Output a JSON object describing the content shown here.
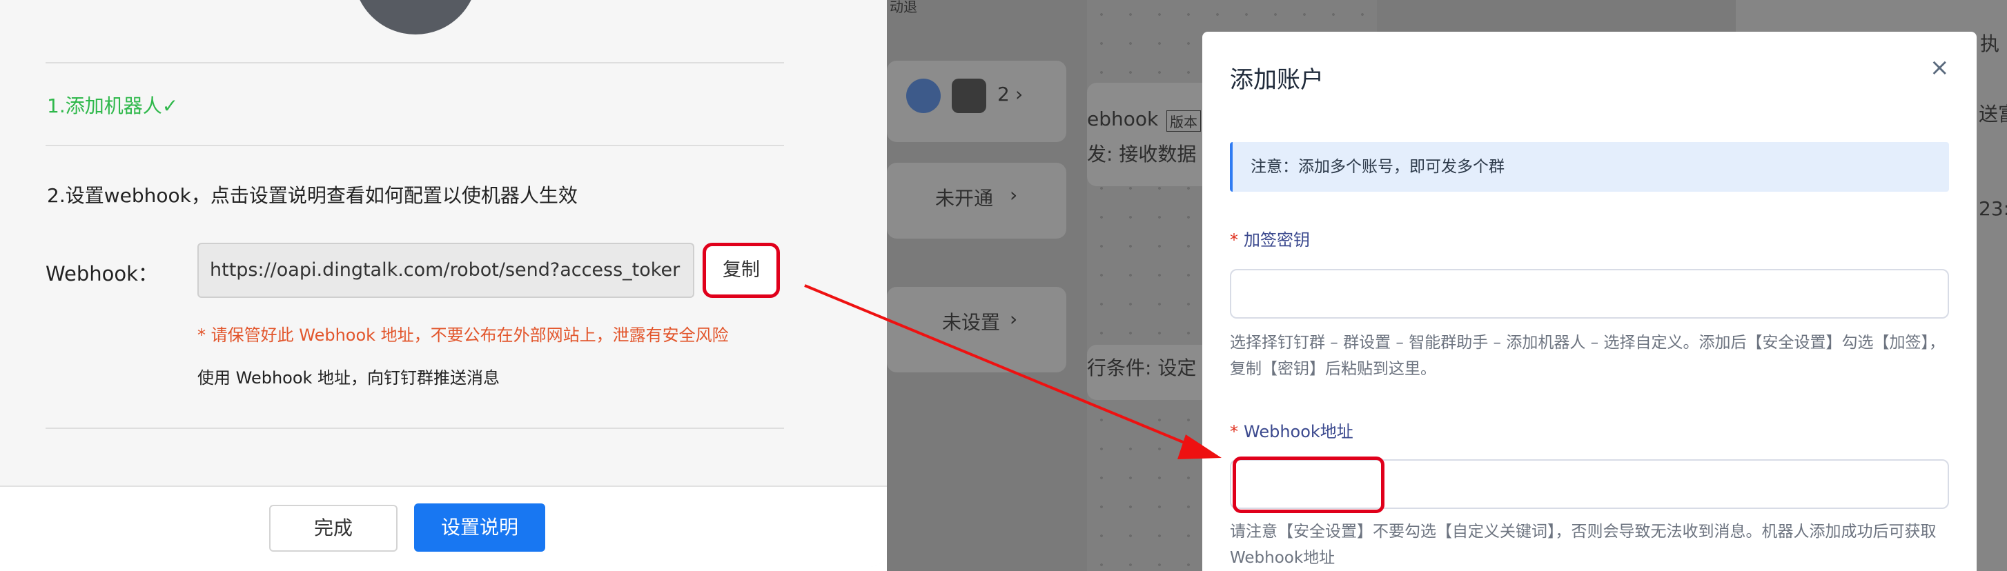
{
  "left_dialog": {
    "step1": "1.添加机器人✓",
    "step2": "2.设置webhook，点击设置说明查看如何配置以使机器人生效",
    "webhook_label": "Webhook：",
    "webhook_value": "https://oapi.dingtalk.com/robot/send?access_toker",
    "copy_button": "复制",
    "warning": "* 请保管好此 Webhook 地址，不要公布在外部网站上，泄露有安全风险",
    "info": "使用 Webhook 地址，向钉钉群推送消息",
    "done_button": "完成",
    "setup_button": "设置说明"
  },
  "background": {
    "top_text": "动退",
    "count": "2",
    "webhook_text": "ebhook",
    "version_badge": "版本",
    "receive_text": "发: 接收数据",
    "not_enabled": "未开通",
    "not_set": "未设置",
    "condition_text": "行条件: 设定",
    "right_top": "执",
    "right_send": "送富",
    "right_time": "23:"
  },
  "modal": {
    "title": "添加账户",
    "close_icon": "×",
    "notice": "注意：添加多个账号，即可发多个群",
    "sign_label": "加签密钥",
    "sign_help": "选择择钉钉群 – 群设置  – 智能群助手 – 添加机器人 – 选择自定义。添加后【安全设置】勾选【加签】，复制【密钥】后粘贴到这里。",
    "webhook_label": "Webhook地址",
    "webhook_help": "请注意【安全设置】不要勾选【自定义关键词】，否则会导致无法收到消息。机器人添加成功后可获取Webhook地址"
  },
  "colors": {
    "success": "#2fb84b",
    "primary": "#1877f2",
    "warning": "#e2552b",
    "highlight": "#e0001b"
  }
}
